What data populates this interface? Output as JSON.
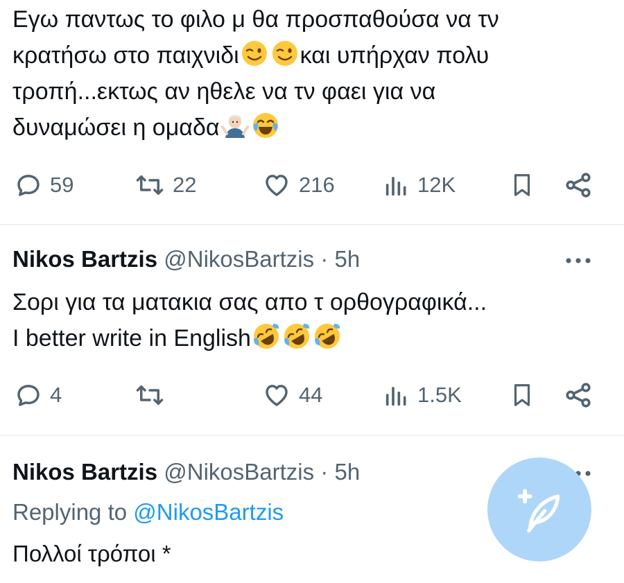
{
  "tweet1": {
    "text_line1": "Εγω παντως το φιλο μ θα προσπαθούσα να τν",
    "text_line2a": "κρατήσω στο παιχνιδι",
    "text_line2b": "και υπήρχαν πολυ",
    "text_line3": "τροπή...εκτως αν ηθελε να τν φαει για να",
    "text_line4": "δυναμώσει η ομαδα",
    "emojis": [
      "winking-face",
      "winking-face",
      "person-shrugging",
      "face-with-tears-of-joy"
    ],
    "actions": {
      "replies": "59",
      "retweets": "22",
      "likes": "216",
      "views": "12K"
    }
  },
  "tweet2": {
    "name": "Nikos Bartzis",
    "handle": "@NikosBartzis",
    "dot": "·",
    "time": "5h",
    "text_line1": "Σορι για τα ματακια σας απο τ ορθογραφικά...",
    "text_line2": "I better write in English",
    "emojis": [
      "rolling-on-floor-laughing",
      "rolling-on-floor-laughing",
      "rolling-on-floor-laughing"
    ],
    "actions": {
      "replies": "4",
      "retweets": "",
      "likes": "44",
      "views": "1.5K"
    }
  },
  "tweet3": {
    "name": "Nikos Bartzis",
    "handle": "@NikosBartzis",
    "dot": "·",
    "time": "5h",
    "replying_prefix": "Replying to",
    "replying_mention": "@NikosBartzis",
    "text": "Πολλοί τρόποι *"
  },
  "colors": {
    "text": "#0f1419",
    "muted": "#536471",
    "link": "#1d9bf0",
    "fab": "#aed6f8",
    "divider": "#eff3f4"
  },
  "icons": [
    "reply-icon",
    "retweet-icon",
    "like-icon",
    "views-icon",
    "bookmark-icon",
    "share-icon",
    "more-icon",
    "compose-icon"
  ]
}
